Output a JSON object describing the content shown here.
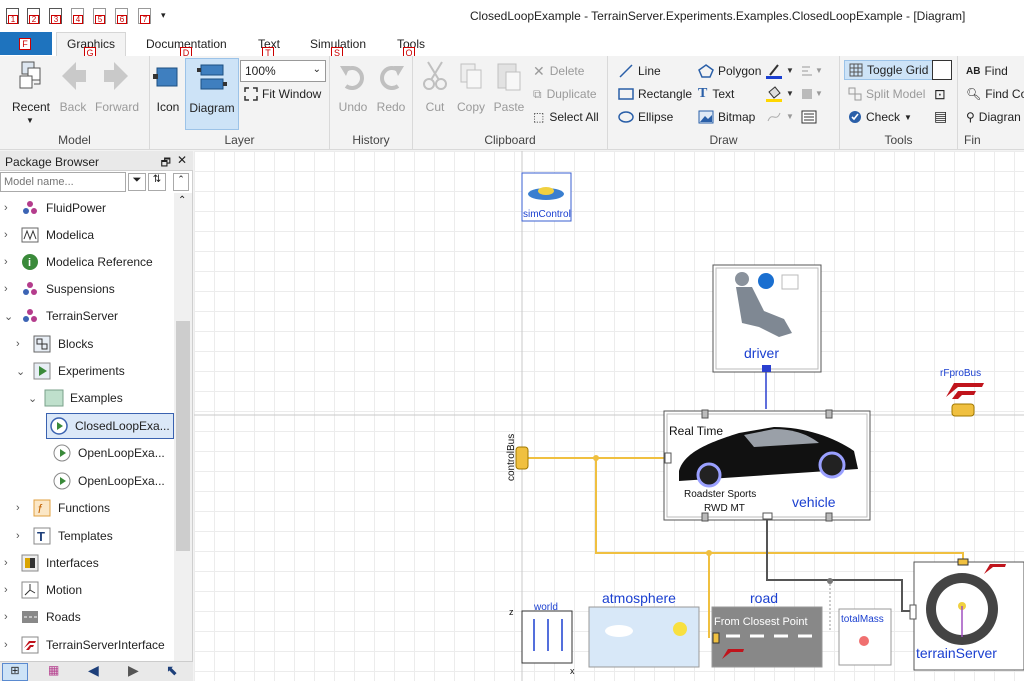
{
  "window": {
    "title": "ClosedLoopExample - TerrainServer.Experiments.Examples.ClosedLoopExample  - [Diagram]"
  },
  "quick_access": [
    "1",
    "2",
    "3",
    "4",
    "5",
    "6",
    "7"
  ],
  "tabs": [
    {
      "label": "F",
      "key": "F"
    },
    {
      "label": "Graphics",
      "key": "G"
    },
    {
      "label": "Documentation",
      "key": "D"
    },
    {
      "label": "Text",
      "key": "T"
    },
    {
      "label": "Simulation",
      "key": "S"
    },
    {
      "label": "Tools",
      "key": "O"
    }
  ],
  "ribbon": {
    "model": {
      "label": "Model",
      "recent": "Recent",
      "back": "Back",
      "forward": "Forward"
    },
    "layer": {
      "label": "Layer",
      "icon": "Icon",
      "diagram": "Diagram",
      "zoom": "100%",
      "fit": "Fit Window"
    },
    "history": {
      "label": "History",
      "undo": "Undo",
      "redo": "Redo"
    },
    "clipboard": {
      "label": "Clipboard",
      "cut": "Cut",
      "copy": "Copy",
      "paste": "Paste",
      "delete": "Delete",
      "duplicate": "Duplicate",
      "select_all": "Select All"
    },
    "draw": {
      "label": "Draw",
      "line": "Line",
      "rectangle": "Rectangle",
      "ellipse": "Ellipse",
      "polygon": "Polygon",
      "text": "Text",
      "bitmap": "Bitmap"
    },
    "tools": {
      "label": "Tools",
      "toggle_grid": "Toggle Grid",
      "split_model": "Split Model",
      "check": "Check"
    },
    "find": {
      "label": "Fin",
      "find": "Find",
      "find_co": "Find Co",
      "diagram": "Diagran"
    }
  },
  "package_browser": {
    "title": "Package Browser",
    "search_placeholder": "Model name...",
    "items": [
      {
        "label": "FluidPower",
        "icon": "fluidpower-icon"
      },
      {
        "label": "Modelica",
        "icon": "modelica-icon"
      },
      {
        "label": "Modelica Reference",
        "icon": "info-icon"
      },
      {
        "label": "Suspensions",
        "icon": "suspensions-icon"
      },
      {
        "label": "TerrainServer",
        "icon": "terrainserver-icon"
      },
      {
        "label": "Blocks",
        "icon": "blocks-icon"
      },
      {
        "label": "Experiments",
        "icon": "play-icon"
      },
      {
        "label": "Examples",
        "icon": "folder-icon"
      },
      {
        "label": "ClosedLoopExa...",
        "icon": "play-icon"
      },
      {
        "label": "OpenLoopExa...",
        "icon": "play-icon"
      },
      {
        "label": "OpenLoopExa...",
        "icon": "play-icon"
      },
      {
        "label": "Functions",
        "icon": "function-icon"
      },
      {
        "label": "Templates",
        "icon": "template-icon"
      },
      {
        "label": "Interfaces",
        "icon": "interfaces-icon"
      },
      {
        "label": "Motion",
        "icon": "motion-icon"
      },
      {
        "label": "Roads",
        "icon": "roads-icon"
      },
      {
        "label": "TerrainServerInterface",
        "icon": "rfpro-icon"
      }
    ]
  },
  "diagram": {
    "simcontrol": "simControl",
    "driver": "driver",
    "rfprobus": "rFproBus",
    "rfpro": "rFpro",
    "controlbus": "controlBus",
    "realtime": "Real Time",
    "roadster": "Roadster Sports",
    "rwd": "RWD MT",
    "vehicle": "vehicle",
    "world": "world",
    "atmosphere": "atmosphere",
    "road": "road",
    "closest_point": "From Closest Point",
    "totalmass": "totalMass",
    "terrainserver": "terrainServer",
    "axis_z": "z",
    "axis_x": "x"
  }
}
